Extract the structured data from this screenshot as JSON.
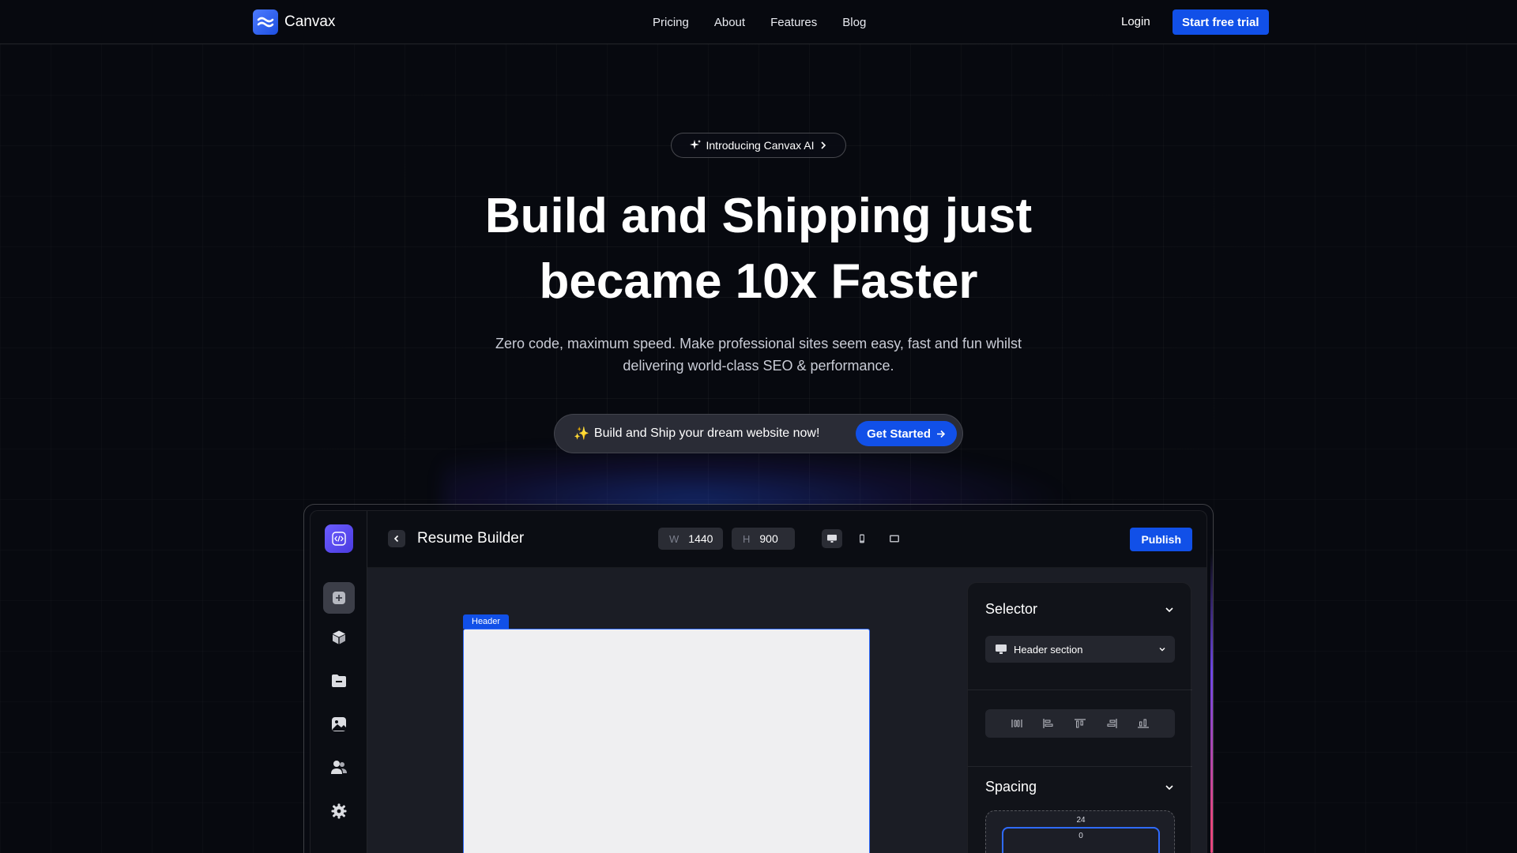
{
  "brand": {
    "name": "Canvax"
  },
  "nav": {
    "links": [
      "Pricing",
      "About",
      "Features",
      "Blog"
    ],
    "login": "Login",
    "trial": "Start free trial"
  },
  "hero": {
    "pill": "Introducing Canvax AI",
    "title_line1": "Build and Shipping just",
    "title_line2": "became 10x Faster",
    "subtitle_line1": "Zero code, maximum speed. Make professional sites seem easy, fast and fun whilst",
    "subtitle_line2": "delivering world-class SEO & performance.",
    "cta_text": "Build and Ship your dream website now!",
    "cta_emoji": "✨",
    "cta_button": "Get Started"
  },
  "app": {
    "title": "Resume Builder",
    "width_label": "W",
    "width_value": "1440",
    "height_label": "H",
    "height_value": "900",
    "publish": "Publish",
    "canvas_tag": "Header"
  },
  "panel": {
    "selector_title": "Selector",
    "selector_value": "Header section",
    "spacing_title": "Spacing",
    "spacing_outer": "24",
    "spacing_inner": "0"
  },
  "colors": {
    "accent": "#1150e8",
    "background": "#07090f",
    "panel": "#111319"
  }
}
